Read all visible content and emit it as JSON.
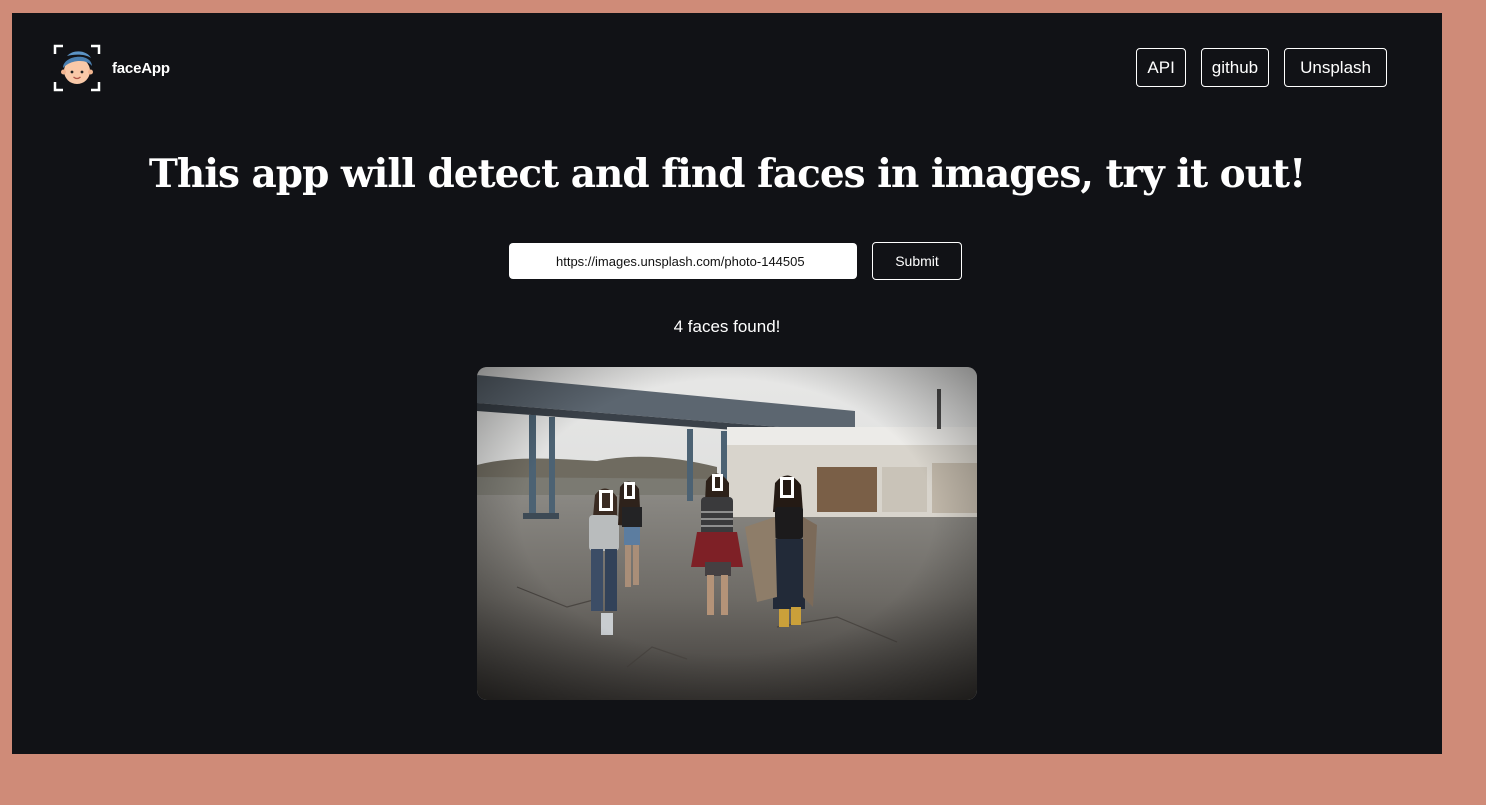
{
  "brand": {
    "name": "faceApp",
    "logo_icon": "face-scan-icon"
  },
  "nav": {
    "api_label": "API",
    "github_label": "github",
    "unsplash_label": "Unsplash"
  },
  "main": {
    "headline": "This app will detect and find faces in images, try it out!",
    "url_value": "https://images.unsplash.com/photo-144505",
    "submit_label": "Submit",
    "result_text": "4 faces found!",
    "face_count": 4
  },
  "colors": {
    "page_background": "#cf8b78",
    "app_background": "#111216",
    "text": "#ffffff",
    "face_box": "#ffffff"
  }
}
